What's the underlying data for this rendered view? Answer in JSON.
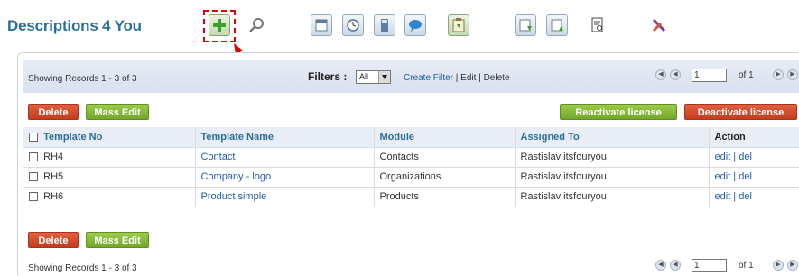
{
  "app": {
    "title": "Descriptions 4 You"
  },
  "toolbar": {
    "icons": [
      "add-icon",
      "search-icon",
      "calendar-icon",
      "clock-icon",
      "calculator-icon",
      "chat-icon",
      "clipboard-icon",
      "import-icon",
      "export-icon",
      "find-duplicates-icon",
      "settings-icon"
    ]
  },
  "list": {
    "showing_text": "Showing Records 1 - 3 of 3",
    "filters_label": "Filters :",
    "filter_value": "All",
    "create_filter": "Create Filter",
    "edit": "Edit",
    "delete": "Delete",
    "sep": " | ",
    "page_value": "1",
    "page_of": "of 1"
  },
  "buttons": {
    "delete": "Delete",
    "mass_edit": "Mass Edit",
    "reactivate": "Reactivate license",
    "deactivate": "Deactivate license"
  },
  "table": {
    "headers": [
      "Template No",
      "Template Name",
      "Module",
      "Assigned To",
      "Action"
    ],
    "rows": [
      {
        "no": "RH4",
        "name": "Contact",
        "module": "Contacts",
        "assigned": "Rastislav itsfouryou",
        "edit": "edit",
        "del": "del"
      },
      {
        "no": "RH5",
        "name": "Company - logo",
        "module": "Organizations",
        "assigned": "Rastislav itsfouryou",
        "edit": "edit",
        "del": "del"
      },
      {
        "no": "RH6",
        "name": "Product simple",
        "module": "Products",
        "assigned": "Rastislav itsfouryou",
        "edit": "edit",
        "del": "del"
      }
    ]
  },
  "colors": {
    "title": "#2a6f9b",
    "link": "#1f5fa8",
    "delete_button": "#c8452a",
    "green_button": "#80b434",
    "highlight": "#e00000"
  }
}
